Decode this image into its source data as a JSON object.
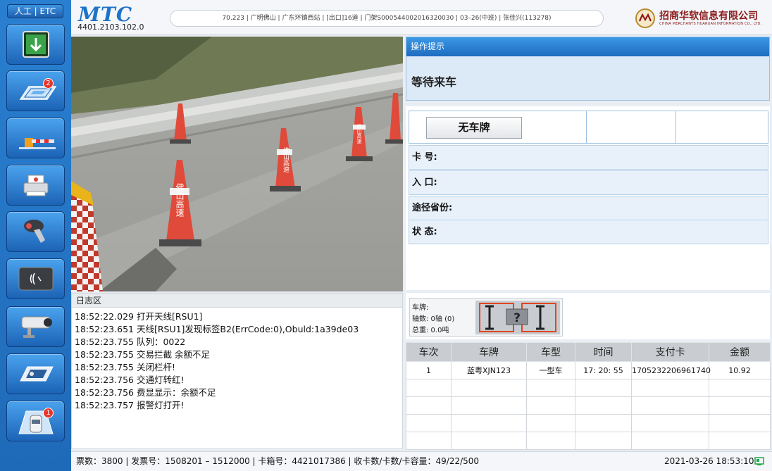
{
  "sidebar": {
    "mode_label": "人工 | ETC",
    "buttons": [
      {
        "name": "download-arrow-icon"
      },
      {
        "name": "etc-lane-icon",
        "badge": "2"
      },
      {
        "name": "barrier-gate-icon"
      },
      {
        "name": "printer-icon"
      },
      {
        "name": "barcode-scanner-icon"
      },
      {
        "name": "card-reader-icon"
      },
      {
        "name": "camera-icon"
      },
      {
        "name": "weigh-plate-icon"
      },
      {
        "name": "vehicle-queue-icon",
        "badge": "1"
      }
    ]
  },
  "header": {
    "logo": "MTC",
    "device_code": "4401.2103.102.0",
    "info_bar": "70.223 | 广明佛山 | 广东环镇西站 | [出口]16道 | 门架S000544002016320030 | 03–26(中班) | 张佳兴(113278)",
    "company_name": "招商华软信息有限公司",
    "company_name_en": "CHINA MERCHANTS HUARUAN INFORMATION CO., LTD."
  },
  "camera": {
    "cone_text": "佛山高速"
  },
  "log": {
    "title": "日志区",
    "lines": [
      "18:52:22.029 打开天线[RSU1]",
      "18:52:23.651 天线[RSU1]发现标签B2(ErrCode:0),Obuld:1a39de03",
      "18:52:23.755 队列：0022",
      "18:52:23.755 交易拦截 余额不足",
      "18:52:23.755 关闭栏杆!",
      "18:52:23.756 交通灯转红!",
      "18:52:23.756 费显显示：余额不足",
      "18:52:23.757 报警灯打开!"
    ]
  },
  "tips": {
    "title": "操作提示",
    "text": "等待来车"
  },
  "vehicle": {
    "plate_button": "无车牌",
    "card_label": "卡  号:",
    "entry_label": "入  口:",
    "province_label": "途径省份:",
    "status_label": "状  态:"
  },
  "axle": {
    "plate_label": "车牌:",
    "axle_label": "轴数:  0轴  (0)",
    "weight_label": "总重:  0.0吨",
    "unknown_mark": "?"
  },
  "transactions": {
    "headers": [
      "车次",
      "车牌",
      "车型",
      "时间",
      "支付卡",
      "金额"
    ],
    "rows": [
      [
        "1",
        "蓝粤XJN123",
        "一型车",
        "17:  20:  55",
        "1705232206961740",
        "10.92"
      ]
    ]
  },
  "status": {
    "text": "票数：3800 | 发票号：1508201 – 1512000 | 卡箱号：4421017386 | 收卡数/卡数/卡容量：49/22/500",
    "time": "2021-03-26 18:53:10"
  },
  "colors": {
    "primary_blue": "#1e73c8",
    "sidebar_blue": "#2a7fd0",
    "panel_light_blue": "#e8f1fa",
    "company_red": "#8b1a1a",
    "status_green": "#1fa84a"
  }
}
